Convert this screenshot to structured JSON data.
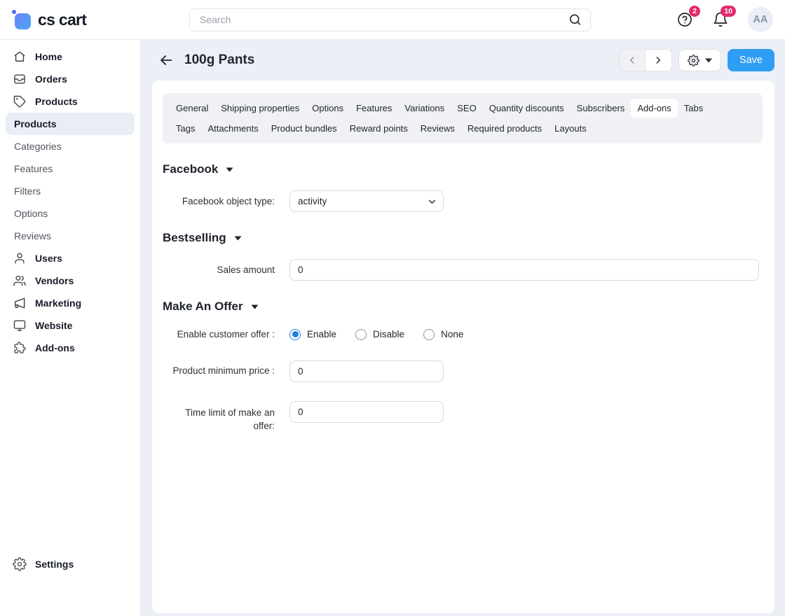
{
  "topbar": {
    "logo_text": "cs cart",
    "search_placeholder": "Search",
    "help_badge": "2",
    "notifications_badge": "10",
    "avatar_initials": "AA"
  },
  "sidebar": {
    "top_items": [
      {
        "label": "Home"
      },
      {
        "label": "Orders"
      },
      {
        "label": "Products"
      }
    ],
    "products_submenu": [
      "Products",
      "Categories",
      "Features",
      "Filters",
      "Options",
      "Reviews"
    ],
    "selected_submenu_item": "Products",
    "bottom_items": [
      {
        "label": "Users"
      },
      {
        "label": "Vendors"
      },
      {
        "label": "Marketing"
      },
      {
        "label": "Website"
      },
      {
        "label": "Add-ons"
      }
    ],
    "settings_label": "Settings"
  },
  "header": {
    "title": "100g Pants",
    "save_label": "Save"
  },
  "tabs": {
    "row1": [
      "General",
      "Shipping properties",
      "Options",
      "Features",
      "Variations",
      "SEO",
      "Quantity discounts",
      "Subscribers",
      "Add-ons",
      "Tabs"
    ],
    "row2": [
      "Tags",
      "Attachments",
      "Product bundles",
      "Reward points",
      "Reviews",
      "Required products",
      "Layouts"
    ],
    "active_tab": "Add-ons"
  },
  "sections": {
    "facebook": {
      "title": "Facebook",
      "object_type_label": "Facebook object type:",
      "object_type_value": "activity"
    },
    "bestselling": {
      "title": "Bestselling",
      "sales_amount_label": "Sales amount",
      "sales_amount_value": "0"
    },
    "make_an_offer": {
      "title": "Make An Offer",
      "enable_label": "Enable customer offer :",
      "options": [
        "Enable",
        "Disable",
        "None"
      ],
      "selected_option": "Enable",
      "min_price_label": "Product minimum price :",
      "min_price_value": "0",
      "time_limit_label": "Time limit of make an offer:",
      "time_limit_value": "0"
    }
  },
  "icons": {
    "logo-mark": "blue-rounded-square-with-dot",
    "search-icon": "magnifier",
    "help-icon": "question-circle",
    "notifications-icon": "bell",
    "back-icon": "arrow-left",
    "prev-icon": "chevron-left",
    "next-icon": "chevron-right",
    "gear-icon": "gear",
    "caret-down-icon": "triangle-down",
    "home-icon": "house",
    "orders-icon": "inbox",
    "products-icon": "tag",
    "users-icon": "person",
    "vendors-icon": "people",
    "marketing-icon": "megaphone",
    "website-icon": "monitor",
    "addons-icon": "puzzle-piece",
    "settings-icon": "gear",
    "select-chevron-icon": "chevron-down"
  },
  "colors": {
    "accent_blue": "#2e9ef4",
    "badge_pink": "#e22c6d",
    "radio_selected_blue": "#1e7fe0",
    "sidebar_selected_bg": "#e9edf6",
    "tabs_bg": "#eff1f5",
    "page_bg": "#eceff6"
  }
}
